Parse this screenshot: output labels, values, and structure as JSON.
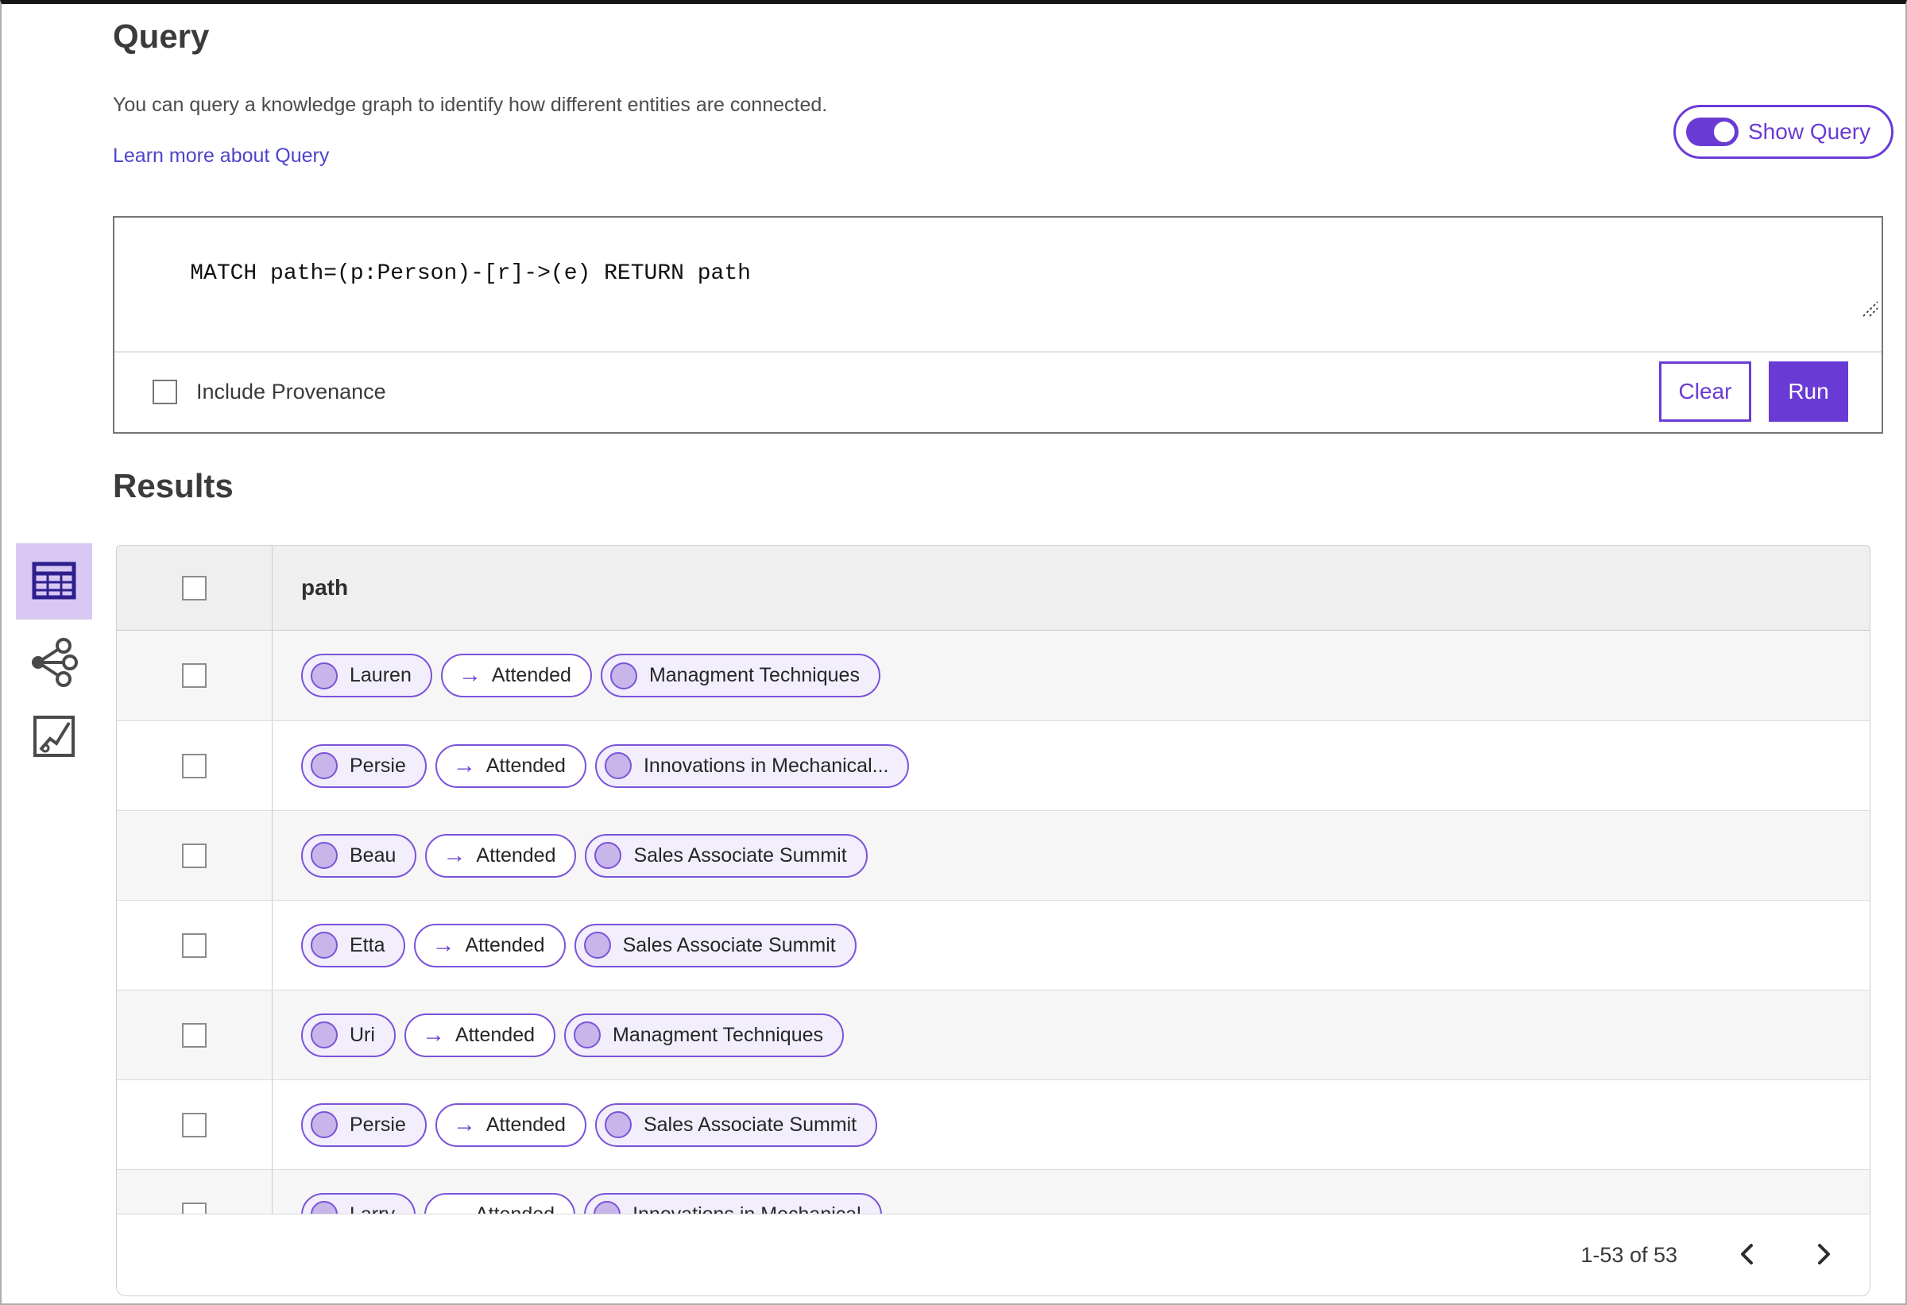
{
  "header": {
    "title": "Query",
    "description": "You can query a knowledge graph to identify how different entities are connected.",
    "learn_more_link": "Learn more about Query",
    "show_query_toggle": {
      "label": "Show Query",
      "state": "on"
    }
  },
  "query_editor": {
    "query_text": "MATCH path=(p:Person)-[r]->(e) RETURN path",
    "include_provenance": {
      "label": "Include Provenance",
      "checked": false
    },
    "clear_button": "Clear",
    "run_button": "Run"
  },
  "results": {
    "title": "Results",
    "view_switcher": [
      {
        "name": "table-view",
        "icon": "table-icon",
        "selected": true
      },
      {
        "name": "graph-view",
        "icon": "network-graph-icon",
        "selected": false
      },
      {
        "name": "chart-view",
        "icon": "chart-box-icon",
        "selected": false
      }
    ],
    "table": {
      "select_all_checked": false,
      "column_header": "path",
      "relation_arrow": "→",
      "rows": [
        {
          "selected": false,
          "person": "Lauren",
          "relation": "Attended",
          "entity": "Managment Techniques"
        },
        {
          "selected": false,
          "person": "Persie",
          "relation": "Attended",
          "entity": "Innovations in Mechanical..."
        },
        {
          "selected": false,
          "person": "Beau",
          "relation": "Attended",
          "entity": "Sales Associate Summit"
        },
        {
          "selected": false,
          "person": "Etta",
          "relation": "Attended",
          "entity": "Sales Associate Summit"
        },
        {
          "selected": false,
          "person": "Uri",
          "relation": "Attended",
          "entity": "Managment Techniques"
        },
        {
          "selected": false,
          "person": "Persie",
          "relation": "Attended",
          "entity": "Sales Associate Summit"
        },
        {
          "selected": false,
          "person": "Larry",
          "relation": "Attended",
          "entity": "Innovations in Mechanical"
        }
      ]
    },
    "pagination": {
      "range_label": "1-53 of 53"
    }
  },
  "colors": {
    "accent_purple": "#6a3bd4",
    "chip_border": "#7b53da",
    "chip_node_bg": "#f2eefb",
    "chip_circle_fill": "#c8b6ea",
    "link": "#4e44c9",
    "selected_icon_bg": "#d9c8f3",
    "row_alt_bg": "#f6f6f6",
    "table_header_bg": "#efefef"
  }
}
